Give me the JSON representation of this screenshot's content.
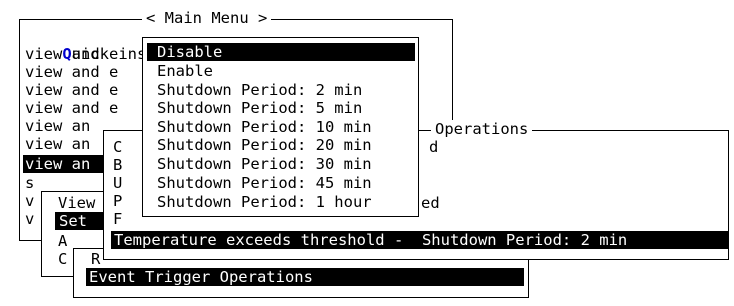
{
  "main_menu": {
    "title": "< Main Menu >",
    "first_item_hotkey": "Q",
    "first_item_rest": "uick inst",
    "items": [
      "view and e",
      "view and e",
      "view and e",
      "view and e",
      "view an",
      "view an",
      "view an",
      "s",
      "v",
      "v"
    ]
  },
  "submenu_a": {
    "items": [
      "View",
      "Set",
      "A",
      "C"
    ],
    "selected": "Set"
  },
  "submenu_b": {
    "items": [
      "R"
    ]
  },
  "event_trigger": {
    "selected_label": "Event Trigger Operations"
  },
  "operations": {
    "title": "Operations",
    "letters": [
      "C",
      "B",
      "U",
      "P",
      "F"
    ],
    "right_fragments": [
      "d",
      "ed"
    ],
    "status_bar": "Temperature exceeds threshold -  Shutdown Period: 2 min"
  },
  "popup": {
    "options": [
      "Disable",
      "Enable",
      "Shutdown Period: 2 min",
      "Shutdown Period: 5 min",
      "Shutdown Period: 10 min",
      "Shutdown Period: 20 min",
      "Shutdown Period: 30 min",
      "Shutdown Period: 45 min",
      "Shutdown Period: 1 hour"
    ],
    "selected_index": 0
  }
}
